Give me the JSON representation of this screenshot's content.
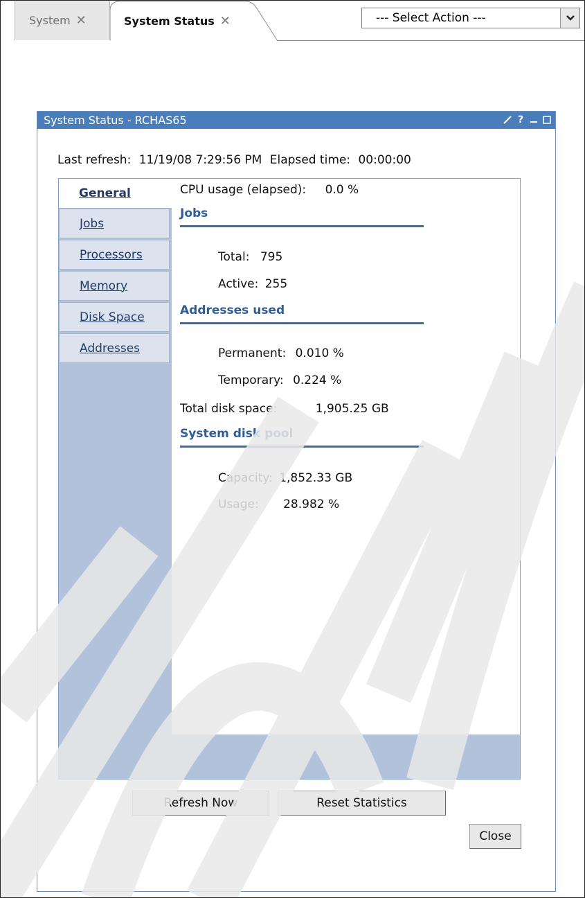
{
  "tabs": [
    {
      "label": "System"
    },
    {
      "label": "System Status"
    }
  ],
  "action_select": {
    "value": "--- Select Action ---"
  },
  "portlet": {
    "title": "System Status - RCHAS65",
    "last_refresh_label": "Last refresh:",
    "last_refresh_value": "11/19/08 7:29:56 PM",
    "elapsed_label": "Elapsed time:",
    "elapsed_value": "00:00:00"
  },
  "nav_tabs": [
    {
      "label": "General",
      "active": true
    },
    {
      "label": "Jobs"
    },
    {
      "label": "Processors"
    },
    {
      "label": "Memory"
    },
    {
      "label": "Disk Space"
    },
    {
      "label": "Addresses"
    }
  ],
  "general": {
    "cpu_label": "CPU usage (elapsed):",
    "cpu_value": "0.0 %",
    "jobs_heading": "Jobs",
    "total_label": "Total:",
    "total_value": "795",
    "active_label": "Active:",
    "active_value": "255",
    "addresses_heading": "Addresses used",
    "permanent_label": "Permanent:",
    "permanent_value": "0.010 %",
    "temporary_label": "Temporary:",
    "temporary_value": "0.224 %",
    "disk_label": "Total disk space:",
    "disk_value": "1,905.25 GB",
    "pool_heading": "System disk pool",
    "capacity_label": "Capacity:",
    "capacity_value": "1,852.33 GB",
    "usage_label": "Usage:",
    "usage_value": "28.982 %"
  },
  "buttons": {
    "refresh": "Refresh Now",
    "reset": "Reset Statistics",
    "close": "Close"
  },
  "colors": {
    "titlebar": "#4a7ebb",
    "sidebar": "#b2c2da",
    "heading": "#2f5d96",
    "link": "#213a66"
  }
}
